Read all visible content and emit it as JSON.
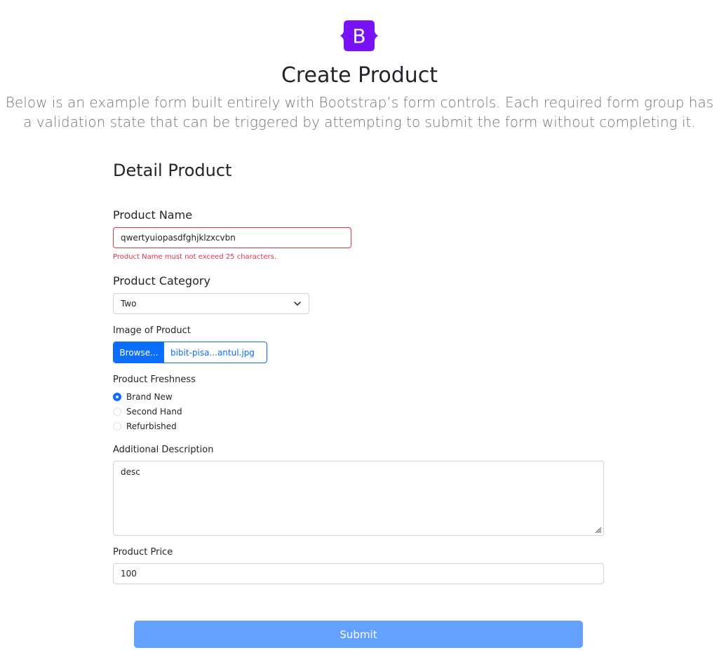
{
  "header": {
    "logo_letter": "B",
    "logo_color": "#7a12f8",
    "title": "Create Product",
    "lead": "Below is an example form built entirely with Bootstrap’s form controls. Each required form group has a validation state that can be triggered by attempting to submit the form without completing it."
  },
  "form": {
    "section_title": "Detail Product",
    "product_name": {
      "label": "Product Name",
      "value": "qwertyuiopasdfghjklzxcvbn",
      "error": "Product Name must not exceed 25 characters."
    },
    "product_category": {
      "label": "Product Category",
      "selected": "Two"
    },
    "image": {
      "label": "Image of Product",
      "browse_label": "Browse...",
      "file_name": "bibit-pisa...antul.jpg"
    },
    "freshness": {
      "label": "Product Freshness",
      "options": [
        {
          "label": "Brand New",
          "checked": true
        },
        {
          "label": "Second Hand",
          "checked": false
        },
        {
          "label": "Refurbished",
          "checked": false
        }
      ]
    },
    "description": {
      "label": "Additional Description",
      "value": "desc"
    },
    "price": {
      "label": "Product Price",
      "value": "100"
    },
    "submit_label": "Submit"
  },
  "colors": {
    "primary": "#0d6efd",
    "danger": "#dc3545",
    "submit_disabled": "#62a1ff"
  }
}
